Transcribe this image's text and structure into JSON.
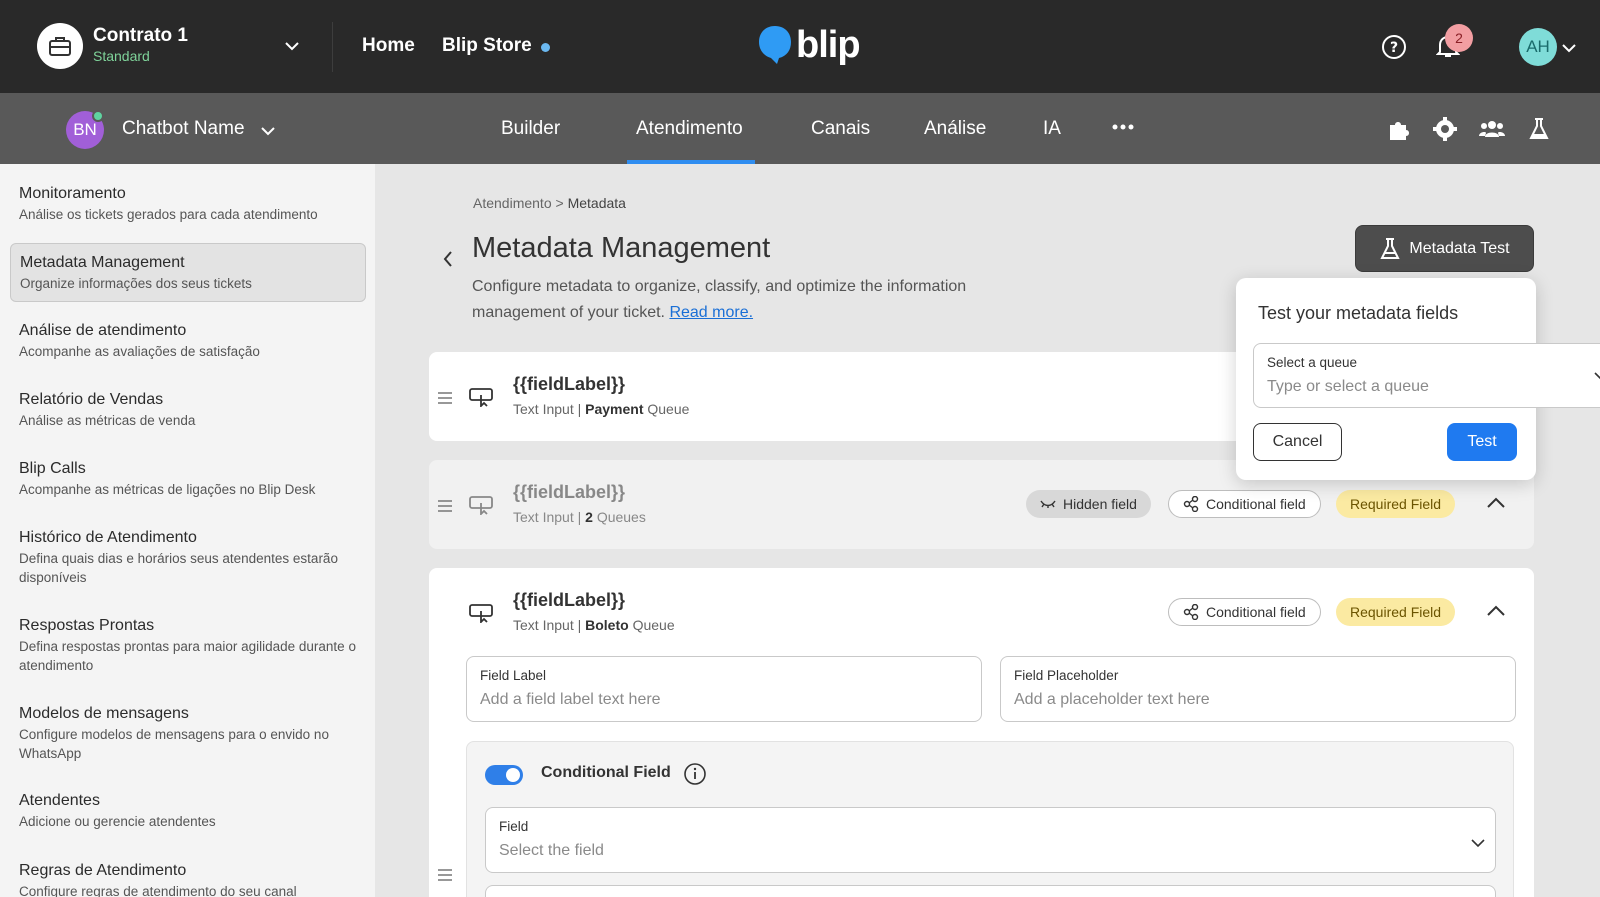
{
  "topbar": {
    "contract_title": "Contrato 1",
    "contract_plan": "Standard",
    "nav_home": "Home",
    "nav_store": "Blip Store",
    "logo_text": "blip",
    "notification_count": "2",
    "user_initials": "AH"
  },
  "subbar": {
    "bot_initials": "BN",
    "bot_name": "Chatbot Name",
    "tabs": [
      {
        "label": "Builder"
      },
      {
        "label": "Atendimento"
      },
      {
        "label": "Canais"
      },
      {
        "label": "Análise"
      },
      {
        "label": "IA"
      }
    ],
    "active_tab": "Atendimento"
  },
  "sidebar": {
    "items": [
      {
        "title": "Monitoramento",
        "desc": "Análise os tickets gerados para cada atendimento"
      },
      {
        "title": "Metadata Management",
        "desc": "Organize informações dos seus tickets"
      },
      {
        "title": "Análise de atendimento",
        "desc": "Acompanhe as avaliações de satisfação"
      },
      {
        "title": "Relatório de Vendas",
        "desc": "Análise as métricas de venda"
      },
      {
        "title": "Blip Calls",
        "desc": "Acompanhe as métricas de ligações no Blip Desk"
      },
      {
        "title": "Histórico de Atendimento",
        "desc": "Defina quais dias e horários seus atendentes estarão disponíveis"
      },
      {
        "title": "Respostas Prontas",
        "desc": "Defina respostas prontas para maior agilidade durante o atendimento"
      },
      {
        "title": "Modelos de mensagens",
        "desc": "Configure modelos de mensagens para o envido no WhatsApp"
      },
      {
        "title": "Atendentes",
        "desc": "Adicione ou gerencie atendentes"
      },
      {
        "title": "Regras de Atendimento",
        "desc": "Configure regras de atendimento do seu canal"
      }
    ]
  },
  "main": {
    "breadcrumb_parent": "Atendimento",
    "breadcrumb_sep": ">",
    "breadcrumb_current": "Metadata",
    "title": "Metadata Management",
    "desc": "Configure metadata to organize, classify, and optimize the information management of your ticket.",
    "read_more": "Read more.",
    "metadata_test_label": "Metadata Test",
    "fields": [
      {
        "label": "{{fieldLabel}}",
        "type": "Text Input",
        "sep": "|",
        "queue_name": "Payment",
        "queue_suffix": "Queue"
      },
      {
        "label": "{{fieldLabel}}",
        "type": "Text Input",
        "sep": "|",
        "queue_name": "2",
        "queue_suffix": "Queues"
      },
      {
        "label": "{{fieldLabel}}",
        "type": "Text Input",
        "sep": "|",
        "queue_name": "Boleto",
        "queue_suffix": "Queue"
      }
    ],
    "chips": {
      "hidden": "Hidden field",
      "conditional": "Conditional field",
      "required": "Required Field"
    },
    "field_label_input": {
      "label": "Field Label",
      "placeholder": "Add a field label text here"
    },
    "field_placeholder_input": {
      "label": "Field Placeholder",
      "placeholder": "Add a placeholder text here"
    },
    "conditional_title": "Conditional Field",
    "conditional_field_select": {
      "label": "Field",
      "placeholder": "Select the field"
    }
  },
  "popover": {
    "title": "Test your metadata fields",
    "select_label": "Select a queue",
    "select_placeholder": "Type or select a queue",
    "cancel_label": "Cancel",
    "test_label": "Test"
  },
  "colors": {
    "topbar_bg": "#292929",
    "subbar_bg": "#595959",
    "accent_blue": "#1f7af0",
    "required_chip_bg": "#fbeaa2",
    "plan_green": "#7fd39a"
  }
}
